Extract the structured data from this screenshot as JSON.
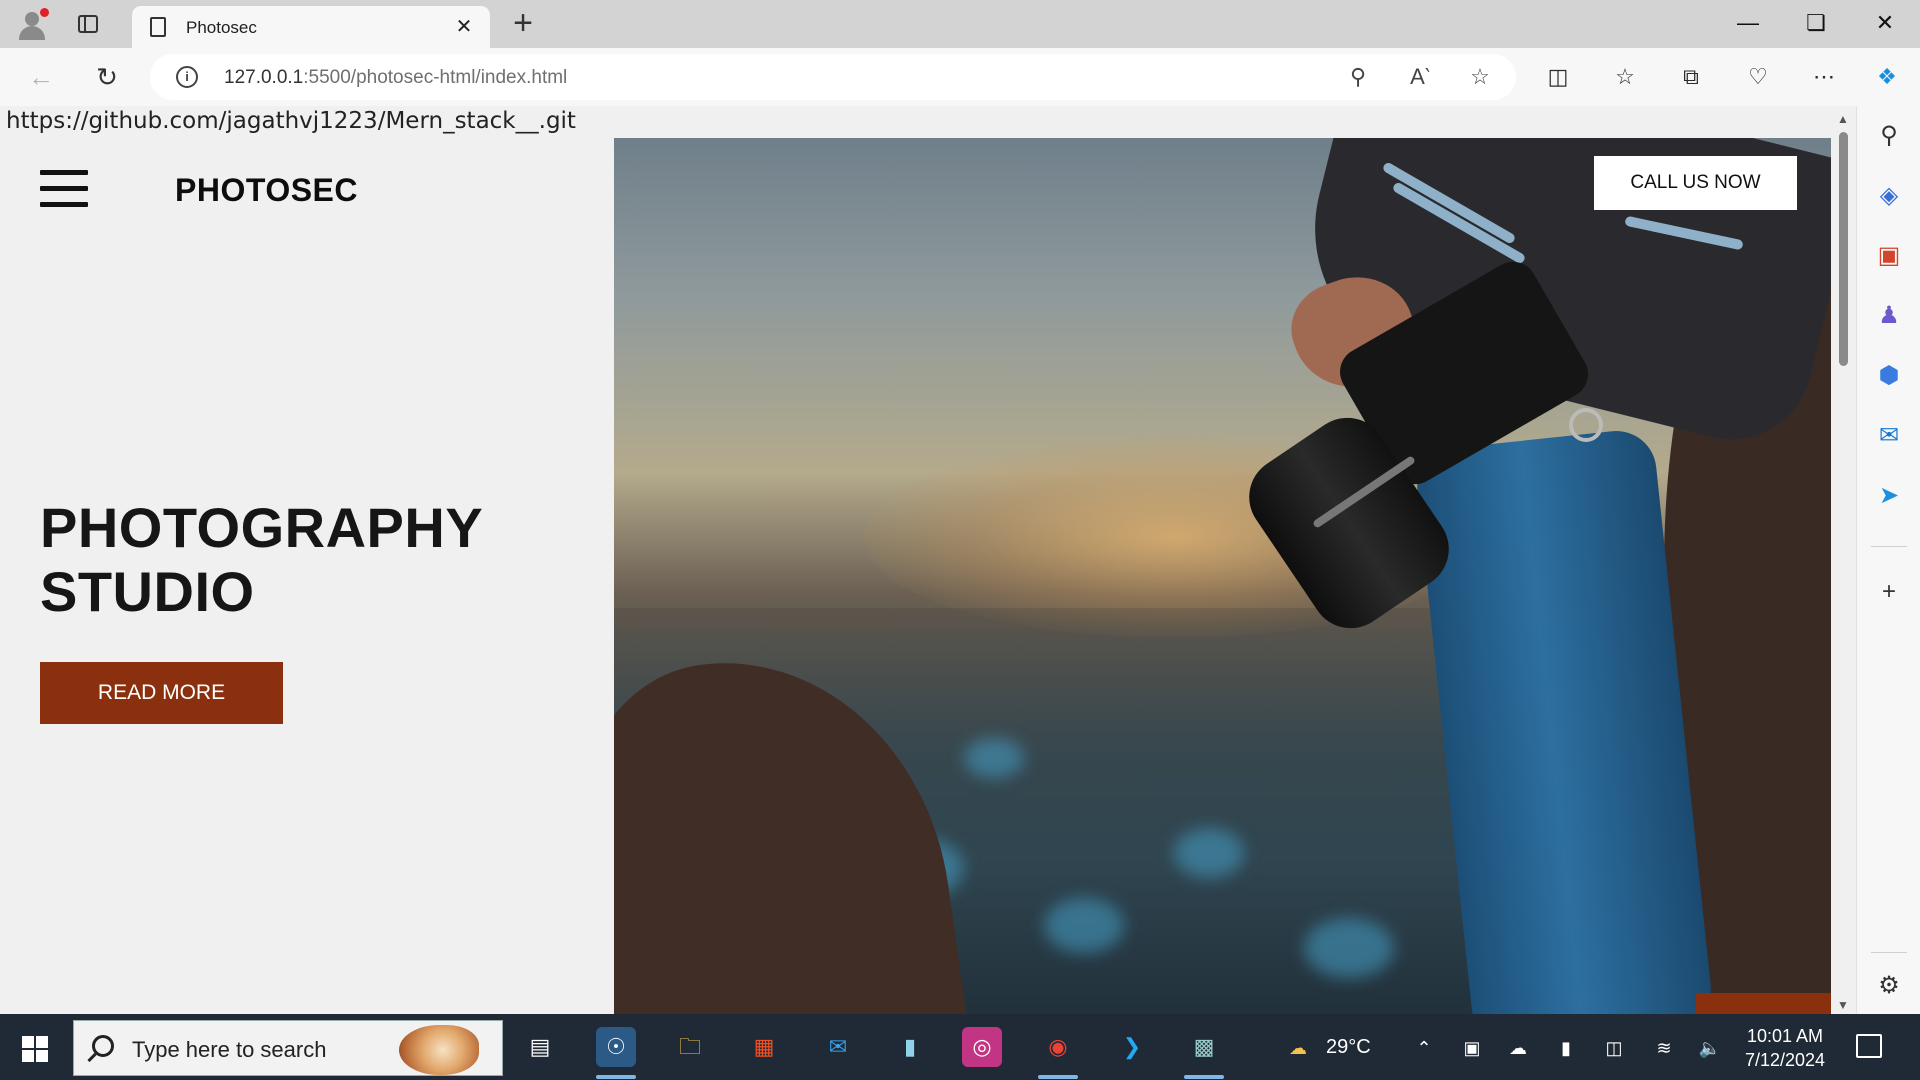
{
  "browser": {
    "tab_title": "Photosec",
    "tab_close": "✕",
    "new_tab": "+",
    "url_host": "127.0.0.1",
    "url_rest": ":5500/photosec-html/index.html",
    "info": "i"
  },
  "page": {
    "git_link": "https://github.com/jagathvj1223/Mern_stack__.git",
    "brand": "PHOTOSEC",
    "hero_line1": "PHOTOGRAPHY",
    "hero_line2": "STUDIO",
    "read_more": "READ MORE",
    "call_us": "CALL US NOW"
  },
  "taskbar": {
    "search_placeholder": "Type here to search",
    "temperature": "29°C",
    "time": "10:01 AM",
    "date": "7/12/2024"
  },
  "icons": [
    "profile-icon",
    "tab-actions-icon",
    "back-icon",
    "refresh-icon",
    "zoom-out-icon",
    "read-aloud-icon",
    "favorite-star-icon",
    "split-screen-icon",
    "favorites-icon",
    "collections-icon",
    "browser-essentials-icon",
    "more-icon",
    "copilot-icon",
    "search-icon",
    "shopping-tag-icon",
    "tools-icon",
    "games-icon",
    "office-icon",
    "outlook-icon",
    "send-icon",
    "add-icon",
    "settings-icon"
  ]
}
